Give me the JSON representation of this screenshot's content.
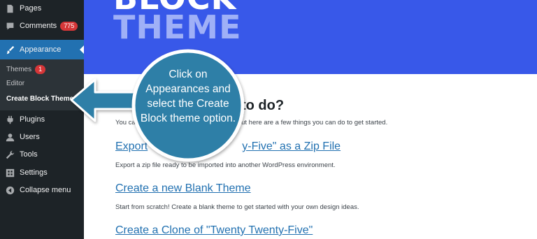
{
  "sidebar": {
    "items": [
      {
        "label": "Pages",
        "icon": "pages-icon"
      },
      {
        "label": "Comments",
        "badge": "775",
        "icon": "comments-icon"
      },
      {
        "label": "Appearance",
        "icon": "paintbrush-icon"
      },
      {
        "label": "Plugins",
        "icon": "plugin-icon"
      },
      {
        "label": "Users",
        "icon": "users-icon"
      },
      {
        "label": "Tools",
        "icon": "wrench-icon"
      },
      {
        "label": "Settings",
        "icon": "settings-icon"
      },
      {
        "label": "Collapse menu",
        "icon": "collapse-icon"
      }
    ],
    "submenu": [
      {
        "label": "Themes",
        "badge": "1"
      },
      {
        "label": "Editor"
      },
      {
        "label": "Create Block Theme"
      }
    ]
  },
  "banner": {
    "line1": "BLOCK",
    "line2": "THEME"
  },
  "main": {
    "heading": "to do?",
    "intro_start": "You ca",
    "intro_link": "or",
    "intro_rest": "but here are a few things you can do to get started.",
    "actions": [
      {
        "link": "Export Twenty Twenty-Five\" as a Zip File",
        "link_visible": "Export                  y-Five\" as a Zip File",
        "desc": "Export a zip file ready to be imported into another WordPress environment."
      },
      {
        "link": "Create a new Blank Theme",
        "desc": "Start from scratch! Create a blank theme to get started with your own design ideas."
      },
      {
        "link": "Create a Clone of \"Twenty Twenty-Five\"",
        "desc": ""
      }
    ]
  },
  "callout": {
    "text": "Click on Appearances and select the Create Block theme option.",
    "color": "#2d7fa7"
  },
  "colors": {
    "sidebar": "#1d2327",
    "active": "#2271b1",
    "banner": "#3858e9",
    "link": "#2271b1",
    "badge": "#d63638"
  }
}
